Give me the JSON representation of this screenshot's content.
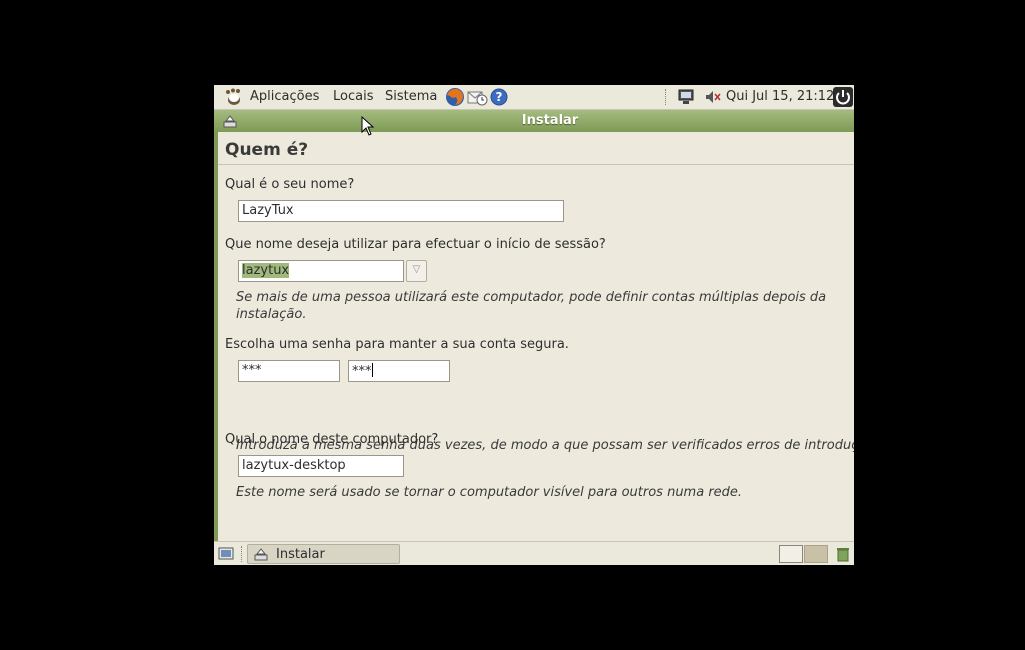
{
  "top_panel": {
    "menus": [
      "Aplicações",
      "Locais",
      "Sistema"
    ],
    "clock": "Qui Jul 15, 21:12"
  },
  "window": {
    "title": "Instalar"
  },
  "form": {
    "heading": "Quem é?",
    "name_label": "Qual é o seu nome?",
    "name_value": "LazyTux",
    "login_label": "Que nome deseja utilizar para efectuar o início de sessão?",
    "login_value": "lazytux",
    "login_hint": "Se mais de uma pessoa utilizará este computador, pode definir contas múltiplas depois da instalação.",
    "password_label": "Escolha uma senha para manter a sua conta segura.",
    "password_value": "***",
    "password_confirm_value": "***",
    "password_hint": "Introduza a mesma senha duas vezes, de modo a que possam ser verificados erros de introduç",
    "hostname_label": "Qual o nome deste computador?",
    "hostname_value": "lazytux-desktop",
    "hostname_hint": "Este nome será usado se tornar o computador visível para outros numa rede."
  },
  "bottom_panel": {
    "task_label": "Instalar"
  },
  "icons": [
    "foot-icon",
    "firefox-icon",
    "mail-icon",
    "help-icon",
    "network-icon",
    "volume-muted-icon",
    "power-icon",
    "installer-icon",
    "show-desktop-icon",
    "trash-icon"
  ]
}
